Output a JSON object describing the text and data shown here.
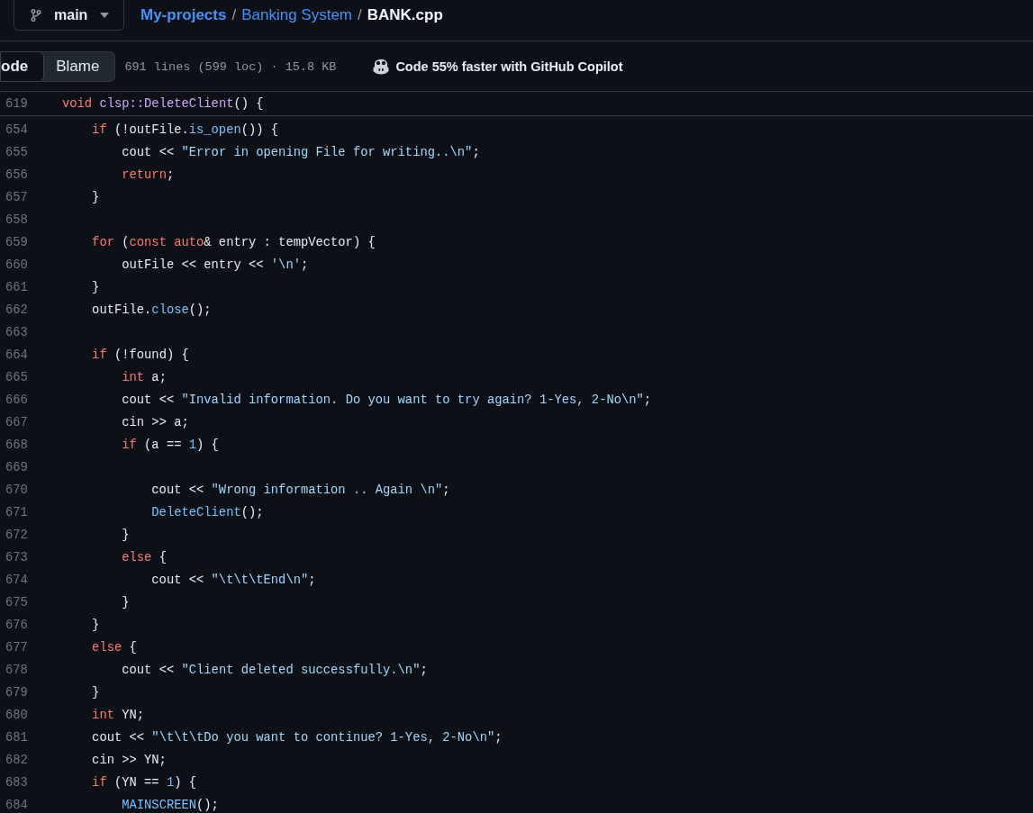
{
  "branch": {
    "name": "main"
  },
  "breadcrumb": [
    {
      "text": "My-projects",
      "kind": "link"
    },
    {
      "text": "/",
      "kind": "sep"
    },
    {
      "text": "Banking System",
      "kind": "link"
    },
    {
      "text": "/",
      "kind": "sep"
    },
    {
      "text": "BANK.cpp",
      "kind": "current"
    }
  ],
  "view_tabs": [
    {
      "label": "ode",
      "selected": true
    },
    {
      "label": "Blame",
      "selected": false
    }
  ],
  "file_info": "691 lines (599 loc) · 15.8 KB",
  "copilot_promo": "Code 55% faster with GitHub Copilot",
  "sticky_line": {
    "number": "619",
    "tokens": [
      {
        "kind": "kw",
        "text": "void "
      },
      {
        "kind": "fn",
        "text": "clsp::DeleteClient"
      },
      {
        "kind": "plain",
        "text": "() {"
      }
    ]
  },
  "lines": [
    {
      "number": "654",
      "tokens": [
        {
          "kind": "kw",
          "text": "if"
        },
        {
          "kind": "plain",
          "text": " (!outFile."
        },
        {
          "kind": "call",
          "text": "is_open"
        },
        {
          "kind": "plain",
          "text": "()) {"
        }
      ],
      "children": [
        {
          "number": "655",
          "tokens": [
            {
              "kind": "plain",
              "text": "cout << "
            },
            {
              "kind": "str",
              "text": "\"Error in opening File for writing..\\n\""
            },
            {
              "kind": "plain",
              "text": ";"
            }
          ]
        },
        {
          "number": "656",
          "tokens": [
            {
              "kind": "kw",
              "text": "return"
            },
            {
              "kind": "plain",
              "text": ";"
            }
          ]
        }
      ]
    },
    {
      "number": "657",
      "tokens": [
        {
          "kind": "plain",
          "text": "}"
        }
      ]
    },
    {
      "number": "658"
    },
    {
      "number": "659",
      "tokens": [
        {
          "kind": "kw",
          "text": "for"
        },
        {
          "kind": "plain",
          "text": " ("
        },
        {
          "kind": "kw",
          "text": "const auto"
        },
        {
          "kind": "plain",
          "text": "& entry : tempVector) {"
        }
      ],
      "children": [
        {
          "number": "660",
          "tokens": [
            {
              "kind": "plain",
              "text": "outFile << entry << "
            },
            {
              "kind": "str",
              "text": "'\\n'"
            },
            {
              "kind": "plain",
              "text": ";"
            }
          ]
        }
      ]
    },
    {
      "number": "661",
      "tokens": [
        {
          "kind": "plain",
          "text": "}"
        }
      ]
    },
    {
      "number": "662",
      "tokens": [
        {
          "kind": "plain",
          "text": "outFile."
        },
        {
          "kind": "call",
          "text": "close"
        },
        {
          "kind": "plain",
          "text": "();"
        }
      ]
    },
    {
      "number": "663"
    },
    {
      "number": "664",
      "tokens": [
        {
          "kind": "kw",
          "text": "if"
        },
        {
          "kind": "plain",
          "text": " (!found) {"
        }
      ],
      "children": [
        {
          "number": "665",
          "tokens": [
            {
              "kind": "kw",
              "text": "int"
            },
            {
              "kind": "plain",
              "text": " a;"
            }
          ]
        },
        {
          "number": "666",
          "tokens": [
            {
              "kind": "plain",
              "text": "cout << "
            },
            {
              "kind": "str",
              "text": "\"Invalid information. Do you want to try again? 1-Yes, 2-No\\n\""
            },
            {
              "kind": "plain",
              "text": ";"
            }
          ]
        },
        {
          "number": "667",
          "tokens": [
            {
              "kind": "plain",
              "text": "cin >> a;"
            }
          ]
        },
        {
          "number": "668",
          "tokens": [
            {
              "kind": "kw",
              "text": "if"
            },
            {
              "kind": "plain",
              "text": " (a == "
            },
            {
              "kind": "num",
              "text": "1"
            },
            {
              "kind": "plain",
              "text": ") {"
            }
          ],
          "children": [
            {
              "number": "669"
            },
            {
              "number": "670",
              "tokens": [
                {
                  "kind": "plain",
                  "text": "cout << "
                },
                {
                  "kind": "str",
                  "text": "\"Wrong information .. Again \\n\""
                },
                {
                  "kind": "plain",
                  "text": ";"
                }
              ]
            },
            {
              "number": "671",
              "tokens": [
                {
                  "kind": "call",
                  "text": "DeleteClient"
                },
                {
                  "kind": "plain",
                  "text": "();"
                }
              ]
            }
          ]
        },
        {
          "number": "672",
          "tokens": [
            {
              "kind": "plain",
              "text": "}"
            }
          ]
        },
        {
          "number": "673",
          "tokens": [
            {
              "kind": "kw",
              "text": "else"
            },
            {
              "kind": "plain",
              "text": " {"
            }
          ],
          "children": [
            {
              "number": "674",
              "tokens": [
                {
                  "kind": "plain",
                  "text": "cout << "
                },
                {
                  "kind": "str",
                  "text": "\"\\t\\t\\tEnd\\n\""
                },
                {
                  "kind": "plain",
                  "text": ";"
                }
              ]
            }
          ]
        },
        {
          "number": "675",
          "tokens": [
            {
              "kind": "plain",
              "text": "}"
            }
          ]
        }
      ]
    },
    {
      "number": "676",
      "tokens": [
        {
          "kind": "plain",
          "text": "}"
        }
      ]
    },
    {
      "number": "677",
      "tokens": [
        {
          "kind": "kw",
          "text": "else"
        },
        {
          "kind": "plain",
          "text": " {"
        }
      ],
      "children": [
        {
          "number": "678",
          "tokens": [
            {
              "kind": "plain",
              "text": "cout << "
            },
            {
              "kind": "str",
              "text": "\"Client deleted successfully.\\n\""
            },
            {
              "kind": "plain",
              "text": ";"
            }
          ]
        }
      ]
    },
    {
      "number": "679",
      "tokens": [
        {
          "kind": "plain",
          "text": "}"
        }
      ]
    },
    {
      "number": "680",
      "tokens": [
        {
          "kind": "kw",
          "text": "int"
        },
        {
          "kind": "plain",
          "text": " YN;"
        }
      ]
    },
    {
      "number": "681",
      "tokens": [
        {
          "kind": "plain",
          "text": "cout << "
        },
        {
          "kind": "str",
          "text": "\"\\t\\t\\tDo you want to continue? 1-Yes, 2-No\\n\""
        },
        {
          "kind": "plain",
          "text": ";"
        }
      ]
    },
    {
      "number": "682",
      "tokens": [
        {
          "kind": "plain",
          "text": "cin >> YN;"
        }
      ]
    },
    {
      "number": "683",
      "tokens": [
        {
          "kind": "kw",
          "text": "if"
        },
        {
          "kind": "plain",
          "text": " (YN == "
        },
        {
          "kind": "num",
          "text": "1"
        },
        {
          "kind": "plain",
          "text": ") {"
        }
      ],
      "children": [
        {
          "number": "684",
          "tokens": [
            {
              "kind": "call",
              "text": "MAINSCREEN"
            },
            {
              "kind": "plain",
              "text": "();"
            }
          ]
        }
      ]
    }
  ]
}
